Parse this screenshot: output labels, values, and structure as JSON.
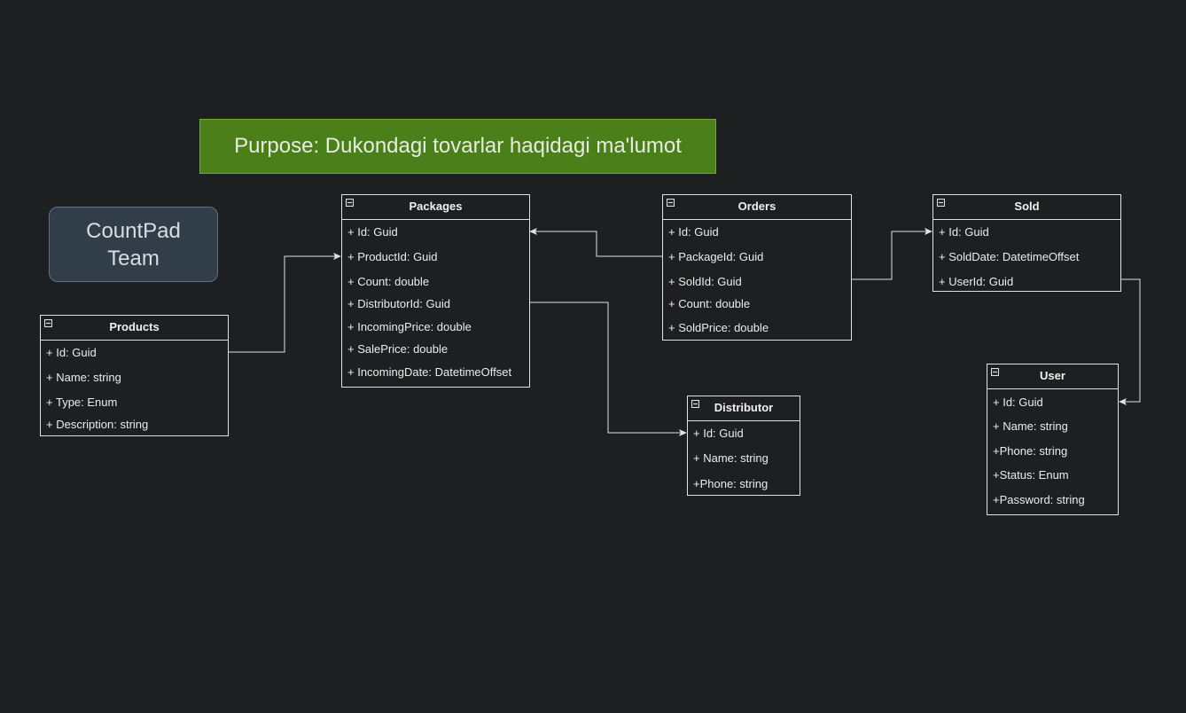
{
  "purpose": "Purpose: Dukondagi tovarlar haqidagi ma'lumot",
  "team": "CountPad\nTeam",
  "entities": {
    "products": {
      "title": "Products",
      "fields": [
        "+ Id: Guid",
        "+ Name: string",
        "+ Type: Enum",
        "+ Description: string"
      ]
    },
    "packages": {
      "title": "Packages",
      "fields": [
        "+ Id: Guid",
        "+ ProductId: Guid",
        "+ Count: double",
        "+ DistributorId: Guid",
        "+ IncomingPrice: double",
        "+ SalePrice: double",
        "+ IncomingDate: DatetimeOffset"
      ]
    },
    "orders": {
      "title": "Orders",
      "fields": [
        "+ Id: Guid",
        "+ PackageId: Guid",
        "+ SoldId: Guid",
        "+ Count: double",
        "+ SoldPrice: double"
      ]
    },
    "sold": {
      "title": "Sold",
      "fields": [
        "+ Id: Guid",
        "+ SoldDate: DatetimeOffset",
        "+ UserId: Guid"
      ]
    },
    "distributor": {
      "title": "Distributor",
      "fields": [
        "+ Id: Guid",
        "+ Name: string",
        "+Phone: string"
      ]
    },
    "user": {
      "title": "User",
      "fields": [
        "+ Id: Guid",
        "+ Name: string",
        "+Phone: string",
        "+Status: Enum",
        "+Password: string"
      ]
    }
  }
}
